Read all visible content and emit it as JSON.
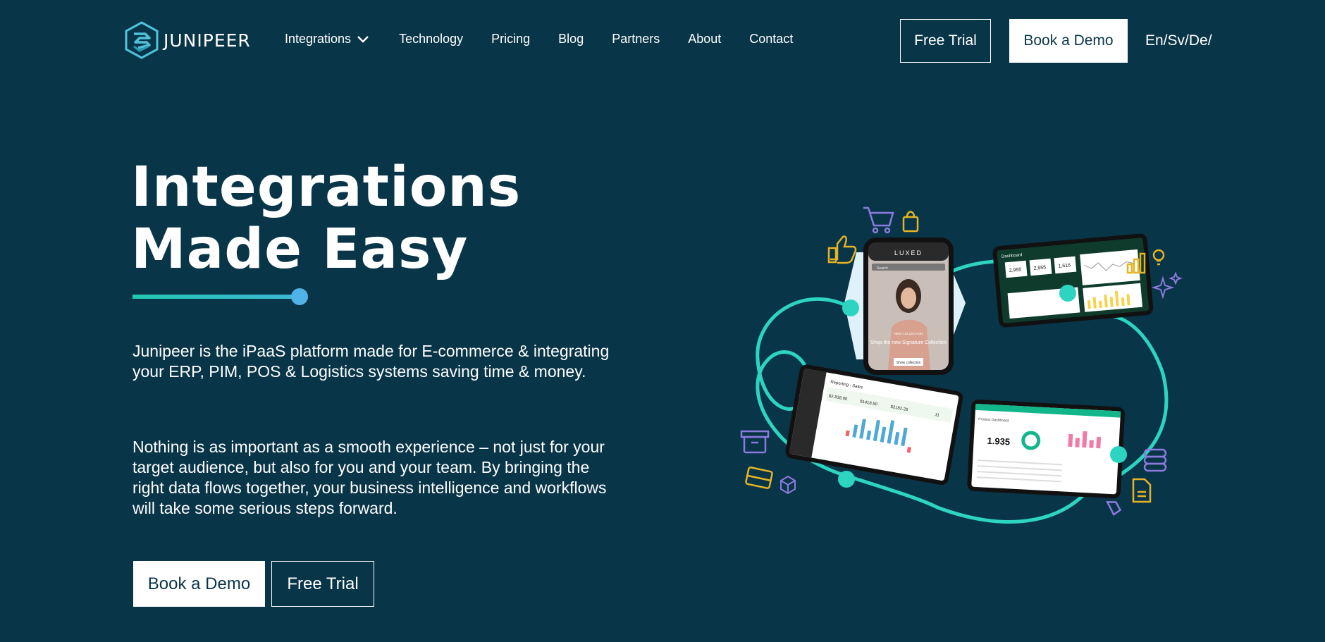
{
  "brand": {
    "name": "JUNIPEER",
    "accent": "#2dd4bf",
    "dot": "#4fb3e8",
    "background": "#093549"
  },
  "nav": {
    "integrations": "Integrations",
    "technology": "Technology",
    "pricing": "Pricing",
    "blog": "Blog",
    "partners": "Partners",
    "about": "About",
    "contact": "Contact"
  },
  "header_actions": {
    "free_trial": "Free Trial",
    "book_demo": "Book a Demo",
    "language": "En/Sv/De/"
  },
  "hero": {
    "title_line1": "Integrations",
    "title_line2": "Made Easy",
    "description1": "Junipeer is the iPaaS platform made for E-commerce & integrating your ERP, PIM, POS & Logistics systems saving time & money.",
    "description2": "Nothing is as important as a smooth experience – not just for your target audience, but also for you and your team. By bringing the right data flows together, your business intelligence and workflows will take some serious steps forward.",
    "book_demo": "Book a Demo",
    "free_trial": "Free Trial"
  },
  "illustration": {
    "phone": {
      "brand": "LUXED",
      "search": "Search",
      "tag": "NEW COLLECTION",
      "headline": "Shop the new Signature Collection",
      "cta": "Show collection"
    },
    "dashboard_top": {
      "title": "Dashboard",
      "stats": [
        "2,955",
        "2,955",
        "1,616"
      ]
    },
    "dashboard_left": {
      "title": "Reporting - Sales",
      "stats": [
        "$2,818.00",
        "$1418.50",
        "$2182.26",
        "11"
      ]
    },
    "dashboard_right": {
      "title": "Product Dashboard",
      "stat": "1.935"
    }
  }
}
